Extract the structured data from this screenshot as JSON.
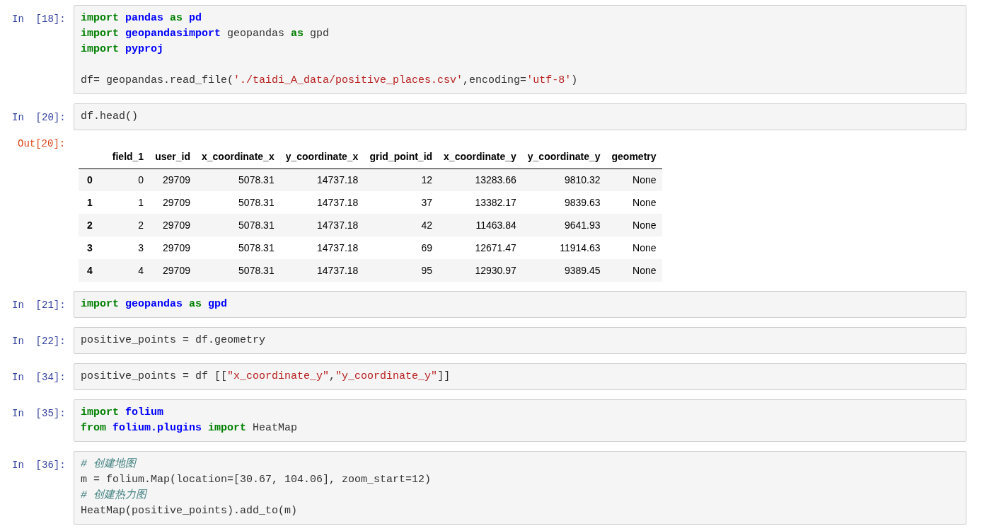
{
  "cells": [
    {
      "prompt": "In  [18]:",
      "lines": [
        {
          "kind": "code",
          "tokens": [
            {
              "kind": "keyword",
              "t": "import "
            },
            {
              "kind": "module",
              "t": "pandas "
            },
            {
              "kind": "keyword",
              "t": "as "
            },
            {
              "kind": "module",
              "t": "pd"
            }
          ]
        },
        {
          "kind": "code",
          "tokens": [
            {
              "kind": "keyword",
              "t": "import "
            },
            {
              "kind": "module",
              "t": "geopandasimport"
            },
            {
              "kind": "plain",
              "t": " geopandas "
            },
            {
              "kind": "keyword",
              "t": "as "
            },
            {
              "kind": "plain",
              "t": "gpd"
            }
          ]
        },
        {
          "kind": "code",
          "tokens": [
            {
              "kind": "keyword",
              "t": "import "
            },
            {
              "kind": "module",
              "t": "pyproj"
            }
          ]
        },
        {
          "kind": "blank"
        },
        {
          "kind": "code",
          "tokens": [
            {
              "kind": "plain",
              "t": "df= geopandas.read_file("
            },
            {
              "kind": "string",
              "t": "'./taidi_A_data/positive_places.csv'"
            },
            {
              "kind": "plain",
              "t": ",encoding="
            },
            {
              "kind": "string",
              "t": "'utf-8'"
            },
            {
              "kind": "plain",
              "t": ")"
            }
          ]
        }
      ]
    },
    {
      "prompt": "In  [20]:",
      "lines": [
        {
          "kind": "code",
          "tokens": [
            {
              "kind": "plain",
              "t": "df.head()"
            }
          ]
        }
      ],
      "output": {
        "prompt": "Out[20]:",
        "table": {
          "columns": [
            "field_1",
            "user_id",
            "x_coordinate_x",
            "y_coordinate_x",
            "grid_point_id",
            "x_coordinate_y",
            "y_coordinate_y",
            "geometry"
          ],
          "rows": [
            {
              "index": "0",
              "cells": [
                "0",
                "29709",
                "5078.31",
                "14737.18",
                "12",
                "13283.66",
                "9810.32",
                "None"
              ]
            },
            {
              "index": "1",
              "cells": [
                "1",
                "29709",
                "5078.31",
                "14737.18",
                "37",
                "13382.17",
                "9839.63",
                "None"
              ]
            },
            {
              "index": "2",
              "cells": [
                "2",
                "29709",
                "5078.31",
                "14737.18",
                "42",
                "11463.84",
                "9641.93",
                "None"
              ]
            },
            {
              "index": "3",
              "cells": [
                "3",
                "29709",
                "5078.31",
                "14737.18",
                "69",
                "12671.47",
                "11914.63",
                "None"
              ]
            },
            {
              "index": "4",
              "cells": [
                "4",
                "29709",
                "5078.31",
                "14737.18",
                "95",
                "12930.97",
                "9389.45",
                "None"
              ]
            }
          ]
        }
      }
    },
    {
      "prompt": "In  [21]:",
      "lines": [
        {
          "kind": "code",
          "tokens": [
            {
              "kind": "keyword",
              "t": "import "
            },
            {
              "kind": "module",
              "t": "geopandas "
            },
            {
              "kind": "keyword",
              "t": "as "
            },
            {
              "kind": "module",
              "t": "gpd"
            }
          ]
        }
      ]
    },
    {
      "prompt": "In  [22]:",
      "lines": [
        {
          "kind": "code",
          "tokens": [
            {
              "kind": "plain",
              "t": "positive_points = df.geometry"
            }
          ]
        }
      ]
    },
    {
      "prompt": "In  [34]:",
      "lines": [
        {
          "kind": "code",
          "tokens": [
            {
              "kind": "plain",
              "t": "positive_points = df [["
            },
            {
              "kind": "string",
              "t": "\"x_coordinate_y\""
            },
            {
              "kind": "plain",
              "t": ","
            },
            {
              "kind": "string",
              "t": "\"y_coordinate_y\""
            },
            {
              "kind": "plain",
              "t": "]]"
            }
          ]
        }
      ]
    },
    {
      "prompt": "In  [35]:",
      "lines": [
        {
          "kind": "code",
          "tokens": [
            {
              "kind": "keyword",
              "t": "import "
            },
            {
              "kind": "module",
              "t": "folium"
            }
          ]
        },
        {
          "kind": "code",
          "tokens": [
            {
              "kind": "keyword",
              "t": "from "
            },
            {
              "kind": "module",
              "t": "folium.plugins "
            },
            {
              "kind": "keyword",
              "t": "import "
            },
            {
              "kind": "plain",
              "t": "HeatMap"
            }
          ]
        }
      ]
    },
    {
      "prompt": "In  [36]:",
      "lines": [
        {
          "kind": "code",
          "tokens": [
            {
              "kind": "comment",
              "t": "# 创建地图"
            }
          ]
        },
        {
          "kind": "code",
          "tokens": [
            {
              "kind": "plain",
              "t": "m = folium.Map(location=[30.67, 104.06], zoom_start=12)"
            }
          ]
        },
        {
          "kind": "code",
          "tokens": [
            {
              "kind": "comment",
              "t": "# 创建热力图"
            }
          ]
        },
        {
          "kind": "code",
          "tokens": [
            {
              "kind": "plain",
              "t": "HeatMap(positive_points).add_to(m)"
            }
          ]
        }
      ]
    }
  ]
}
